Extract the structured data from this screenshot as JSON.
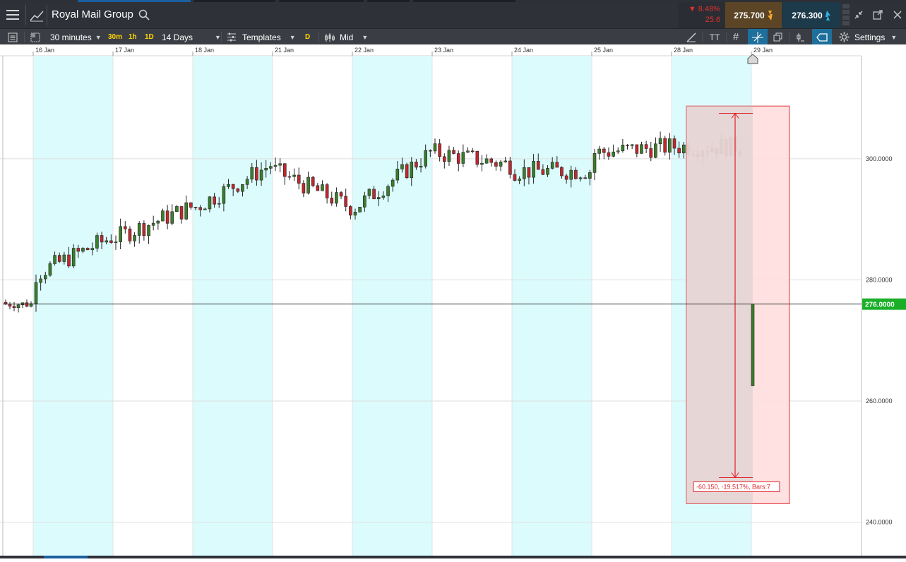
{
  "header": {
    "instrument": "Royal Mail Group",
    "change_pct": "8.48%",
    "change_abs": "25.6",
    "sell_price": "275.700",
    "buy_price": "276.300"
  },
  "toolbar": {
    "interval": "30 minutes",
    "quick_30m": "30m",
    "quick_1h": "1h",
    "quick_1d": "1D",
    "period": "14 Days",
    "templates": "Templates",
    "draw_letter": "D",
    "price_type": "Mid",
    "settings": "Settings",
    "text_tool": "TT"
  },
  "colors": {
    "up_candle": "#3a7d2c",
    "down_candle": "#c0272d",
    "session_shade": "#dcfbfd",
    "measure_box": "#ffdede",
    "measure_border": "#e0222a",
    "price_badge": "#1aaf27",
    "header_bg": "#2e3238",
    "sell_bg": "#5b4526",
    "buy_bg": "#1d3a4b"
  },
  "chart_data": {
    "type": "candlestick",
    "interval": "30 minutes",
    "period": "14 Days",
    "x_labels": [
      "16 Jan",
      "17 Jan",
      "18 Jan",
      "21 Jan",
      "22 Jan",
      "23 Jan",
      "24 Jan",
      "25 Jan",
      "28 Jan",
      "29 Jan"
    ],
    "y_ticks": [
      "300.0000",
      "280.0000",
      "260.0000",
      "240.0000"
    ],
    "ylim": [
      234,
      317
    ],
    "current_price": "276.0000",
    "measure_label": "-60.150, -19.517%, Bars:7",
    "last_candle": {
      "open": 262.5,
      "high": 276.0,
      "low": 262.5,
      "close": 276.0
    },
    "sessions": [
      {
        "label": "16 Jan",
        "bars": 17,
        "open": 281,
        "close": 287,
        "shaded": true
      },
      {
        "label": "17 Jan",
        "bars": 17,
        "open": 287,
        "close": 292,
        "shaded": false
      },
      {
        "label": "18 Jan",
        "bars": 17,
        "open": 292,
        "close": 299,
        "shaded": true
      },
      {
        "label": "21 Jan",
        "bars": 17,
        "open": 298,
        "close": 292,
        "shaded": false
      },
      {
        "label": "22 Jan",
        "bars": 17,
        "open": 292,
        "close": 301,
        "shaded": true
      },
      {
        "label": "23 Jan",
        "bars": 17,
        "open": 301,
        "close": 299,
        "shaded": false
      },
      {
        "label": "24 Jan",
        "bars": 17,
        "open": 298,
        "close": 298,
        "shaded": true
      },
      {
        "label": "25 Jan",
        "bars": 17,
        "open": 301,
        "close": 302,
        "shaded": false
      },
      {
        "label": "28 Jan",
        "bars": 15,
        "open": 302,
        "close": 302,
        "shaded": true
      }
    ]
  }
}
